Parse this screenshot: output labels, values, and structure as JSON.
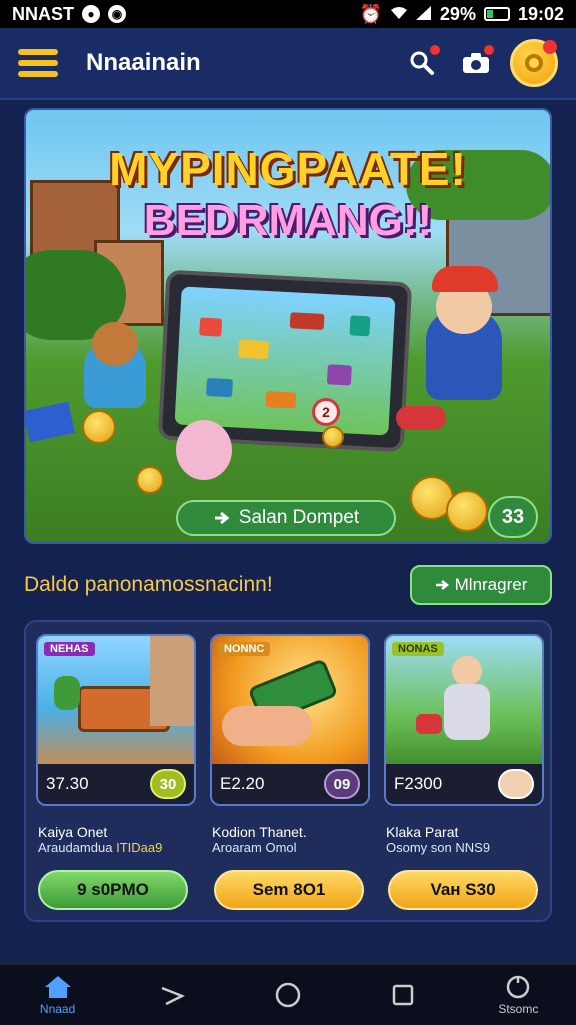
{
  "status_bar": {
    "left_text": "NNAST",
    "battery": "29%",
    "battery_level": 0.29,
    "time": "19:02"
  },
  "app_bar": {
    "title": "Nnaainain",
    "icons": [
      "menu-icon",
      "search-icon",
      "camera-icon",
      "coin-icon"
    ]
  },
  "hero": {
    "title_line1": "MYPINGPAATE!",
    "title_line2": "BEDRMANG!!",
    "cta_label": "Salan Dompet",
    "cta_icon": "arrow-icon",
    "count": "33",
    "badge_number": "2"
  },
  "section": {
    "title": "Daldo panonamossnacinn!",
    "button_label": "Mlnragrer"
  },
  "cards": [
    {
      "tag": "NEHAS",
      "price": "37.30",
      "pill": "30",
      "line1": "Kaiya Onet",
      "line2_prefix": "Araudamdua",
      "line2_highlight": "ITIDaa9",
      "button_label": "9 s0PMO",
      "button_style": "green"
    },
    {
      "tag": "NONNC",
      "price": "E2.20",
      "pill": "09",
      "line1": "Kodion Thanet.",
      "line2_prefix": "Aroaram Omol",
      "line2_highlight": "",
      "button_label": "Sem 8O1",
      "button_style": "yellow"
    },
    {
      "tag": "NONAS",
      "price": "F2300",
      "pill": "",
      "line1": "Klaka Parat",
      "line2_prefix": "Osomy son",
      "line2_highlight": "NNS9",
      "button_label": "Vaн S30",
      "button_style": "yellow"
    }
  ],
  "nav": {
    "items": [
      {
        "label": "Nnaad",
        "icon": "home-icon",
        "active": true
      },
      {
        "label": "",
        "icon": "back-icon",
        "active": false
      },
      {
        "label": "",
        "icon": "home-circle-icon",
        "active": false
      },
      {
        "label": "",
        "icon": "recents-icon",
        "active": false
      },
      {
        "label": "Stsomc",
        "icon": "settings-icon",
        "active": false
      }
    ]
  },
  "colors": {
    "background": "#14224f",
    "accent_yellow": "#f6c21c",
    "accent_green": "#3e9b36"
  }
}
